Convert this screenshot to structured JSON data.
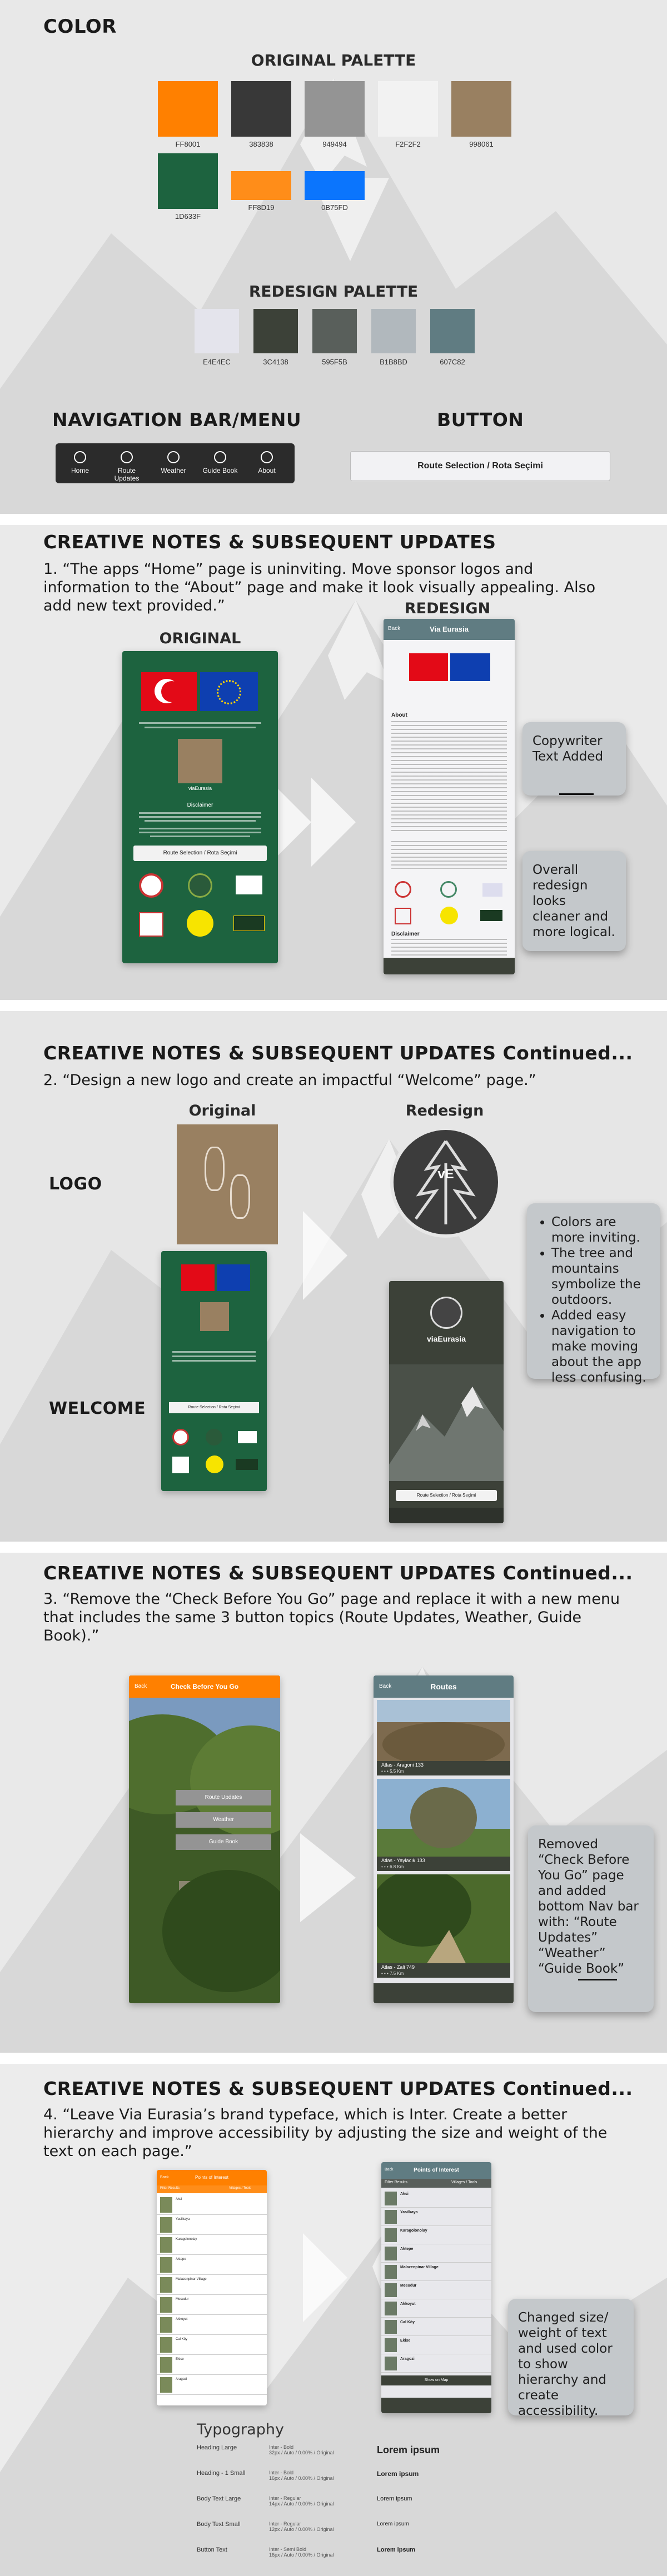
{
  "colors": {
    "orange": "#FF8000",
    "dark": "#383838",
    "mid_gray": "#949494",
    "light_gray": "#F2F2F2",
    "tan": "#998061",
    "green": "#1D633F",
    "orange2": "#FF8D19",
    "blue": "#0B75FD",
    "r1": "#E4E4EC",
    "r2": "#3C4138",
    "r3": "#595F5B",
    "r4": "#B1B8BD",
    "r5": "#607C82"
  },
  "section1": {
    "heading": "COLOR",
    "original_palette_title": "ORIGINAL PALETTE",
    "original_swatches": [
      "FF8001",
      "383838",
      "949494",
      "F2F2F2",
      "998061",
      "1D633F",
      "FF8D19",
      "0B75FD"
    ],
    "redesign_palette_title": "REDESIGN PALETTE",
    "redesign_swatches": [
      "E4E4EC",
      "3C4138",
      "595F5B",
      "B1B8BD",
      "607C82"
    ],
    "nav_title": "NAVIGATION BAR/MENU",
    "nav_items": [
      "Home",
      "Route Updates",
      "Weather",
      "Guide Book",
      "About"
    ],
    "button_title": "BUTTON",
    "button_label": "Route Selection / Rota Seçimi"
  },
  "section2": {
    "heading": "CREATIVE NOTES & SUBSEQUENT UPDATES",
    "note": "1. “The apps “Home” page is uninviting.  Move sponsor logos and information to the “About” page and make it look visually appealing. Also add new text provided.”",
    "original_label": "ORIGINAL",
    "redesign_label": "REDESIGN",
    "phone_title": "Via Eurasia",
    "phone_back": "Back",
    "about_label": "About",
    "disclaimer_label": "Disclaimer",
    "route_button": "Route Selection / Rota Seçimi",
    "brand": "viaEurasia",
    "callout1": "Copywriter Text Added",
    "callout2": "Overall redesign looks cleaner and more logical."
  },
  "section3": {
    "heading": "CREATIVE NOTES & SUBSEQUENT UPDATES Continued...",
    "note": "2. “Design a new logo and create an impactful “Welcome” page.”",
    "original_label": "Original",
    "redesign_label": "Redesign",
    "logo_label": "LOGO",
    "welcome_label": "WELCOME",
    "logo_initials": "vE",
    "welcome_brand": "viaEurasia",
    "welcome_button": "Route Selection / Rota Seçimi",
    "bullets": [
      "Colors are more inviting.",
      "The  tree and mountains symbolize the outdoors.",
      "Added easy navigation to make moving about the app less confusing."
    ]
  },
  "section4": {
    "heading": "CREATIVE NOTES & SUBSEQUENT UPDATES Continued...",
    "note": "3. “Remove the “Check Before You Go” page and replace it with a new menu that includes the same 3 button topics (Route Updates, Weather, Guide Book).”",
    "orig_title": "Check Before You Go",
    "orig_back": "Back",
    "orig_buttons": [
      "Route Updates",
      "Weather",
      "Guide Book"
    ],
    "new_title": "Routes",
    "new_back": "Back",
    "route_cards": [
      {
        "name": "Atlas - Aragoni 133",
        "meta": "• • • 5.5 Km"
      },
      {
        "name": "Atlas - Yaylacık 133",
        "meta": "• • • 6.8 Km"
      },
      {
        "name": "Atlas - Zali 749",
        "meta": "• • • 7.5 Km"
      }
    ],
    "callout": "Removed “Check Before You Go” page and added bottom Nav bar with: “Route Updates” “Weather” “Guide Book”"
  },
  "section5": {
    "heading": "CREATIVE NOTES & SUBSEQUENT UPDATES Continued...",
    "note": "4. “Leave Via Eurasia’s brand typeface, which is Inter.  Create a better hierarchy and improve accessibility by adjusting the size and weight of the text on each page.”",
    "orig_title": "Points of Interest",
    "orig_back": "Back",
    "orig_filter_left": "Filter Results",
    "orig_filter_right": "Villages  /  Tools",
    "new_title": "Points of Interest",
    "new_back": "Back",
    "new_filter_left": "Filter Results",
    "new_filter_right": "Villages  /  Tools",
    "poi": [
      "Aksi",
      "Yasilkaya",
      "Karagolonolay",
      "Aktepe",
      "Malazenpinar Village",
      "Mesudur",
      "Akkoyut",
      "Cal Köy",
      "Ekise",
      "Aragozi"
    ],
    "show_on_map": "Show on Map",
    "callout": "Changed size/ weight of text and used color to show hierarchy and create accessibility.",
    "typography_title": "Typography",
    "typo_rows": [
      {
        "name": "Heading Large",
        "spec": "Inter - Bold\n32px / Auto / 0.00% / Original",
        "sample": "Lorem ipsum"
      },
      {
        "name": "Heading - 1 Small",
        "spec": "Inter - Bold\n16px / Auto / 0.00% / Original",
        "sample": "Lorem ipsum"
      },
      {
        "name": "Body Text Large",
        "spec": "Inter - Regular\n14px / Auto / 0.00% / Original",
        "sample": "Lorem ipsum"
      },
      {
        "name": "Body Text Small",
        "spec": "Inter - Regular\n12px / Auto / 0.00% / Original",
        "sample": "Lorem ipsum"
      },
      {
        "name": "Button Text",
        "spec": "Inter - Semi Bold\n16px / Auto / 0.00% / Original",
        "sample": "Lorem ipsum"
      }
    ]
  },
  "nav_small": [
    "Home",
    "Route Updates",
    "Weather",
    "Guide Book",
    "About"
  ]
}
